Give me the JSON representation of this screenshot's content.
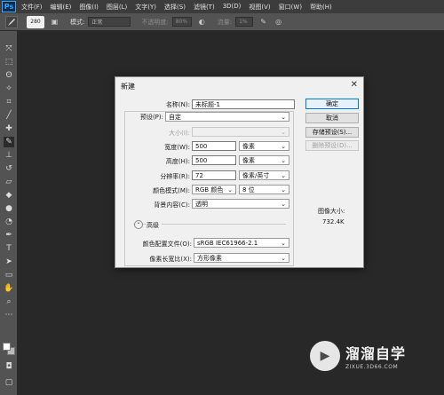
{
  "app": {
    "logo": "Ps"
  },
  "menu": [
    "文件(F)",
    "编辑(E)",
    "图像(I)",
    "图层(L)",
    "文字(Y)",
    "选择(S)",
    "滤镜(T)",
    "3D(D)",
    "视图(V)",
    "窗口(W)",
    "帮助(H)"
  ],
  "options": {
    "brush_size": "280",
    "mode_label": "模式:",
    "mode_value": "正常",
    "opacity_label": "不透明度:",
    "opacity_value": "80%",
    "flow_label": "流量:",
    "flow_value": "1%"
  },
  "dialog": {
    "title": "新建",
    "close": "✕",
    "name_label": "名称(N):",
    "name_value": "未标题-1",
    "preset_label": "预设(P):",
    "preset_value": "自定",
    "size_label": "大小(I):",
    "width_label": "宽度(W):",
    "width_value": "500",
    "width_unit": "像素",
    "height_label": "高度(H):",
    "height_value": "500",
    "height_unit": "像素",
    "resolution_label": "分辨率(R):",
    "resolution_value": "72",
    "resolution_unit": "像素/英寸",
    "color_mode_label": "颜色模式(M):",
    "color_mode_value": "RGB 颜色",
    "bit_depth_value": "8 位",
    "bg_label": "背景内容(C):",
    "bg_value": "透明",
    "advanced_label": "高级",
    "color_profile_label": "颜色配置文件(O):",
    "color_profile_value": "sRGB IEC61966-2.1",
    "pixel_aspect_label": "像素长宽比(X):",
    "pixel_aspect_value": "方形像素",
    "ok_label": "确定",
    "cancel_label": "取消",
    "save_preset_label": "存储预设(S)...",
    "delete_preset_label": "删除预设(D)...",
    "image_size_label": "图像大小:",
    "image_size_value": "732.4K"
  },
  "watermark": {
    "title": "溜溜自学",
    "url": "ZIXUE.3D66.COM"
  }
}
